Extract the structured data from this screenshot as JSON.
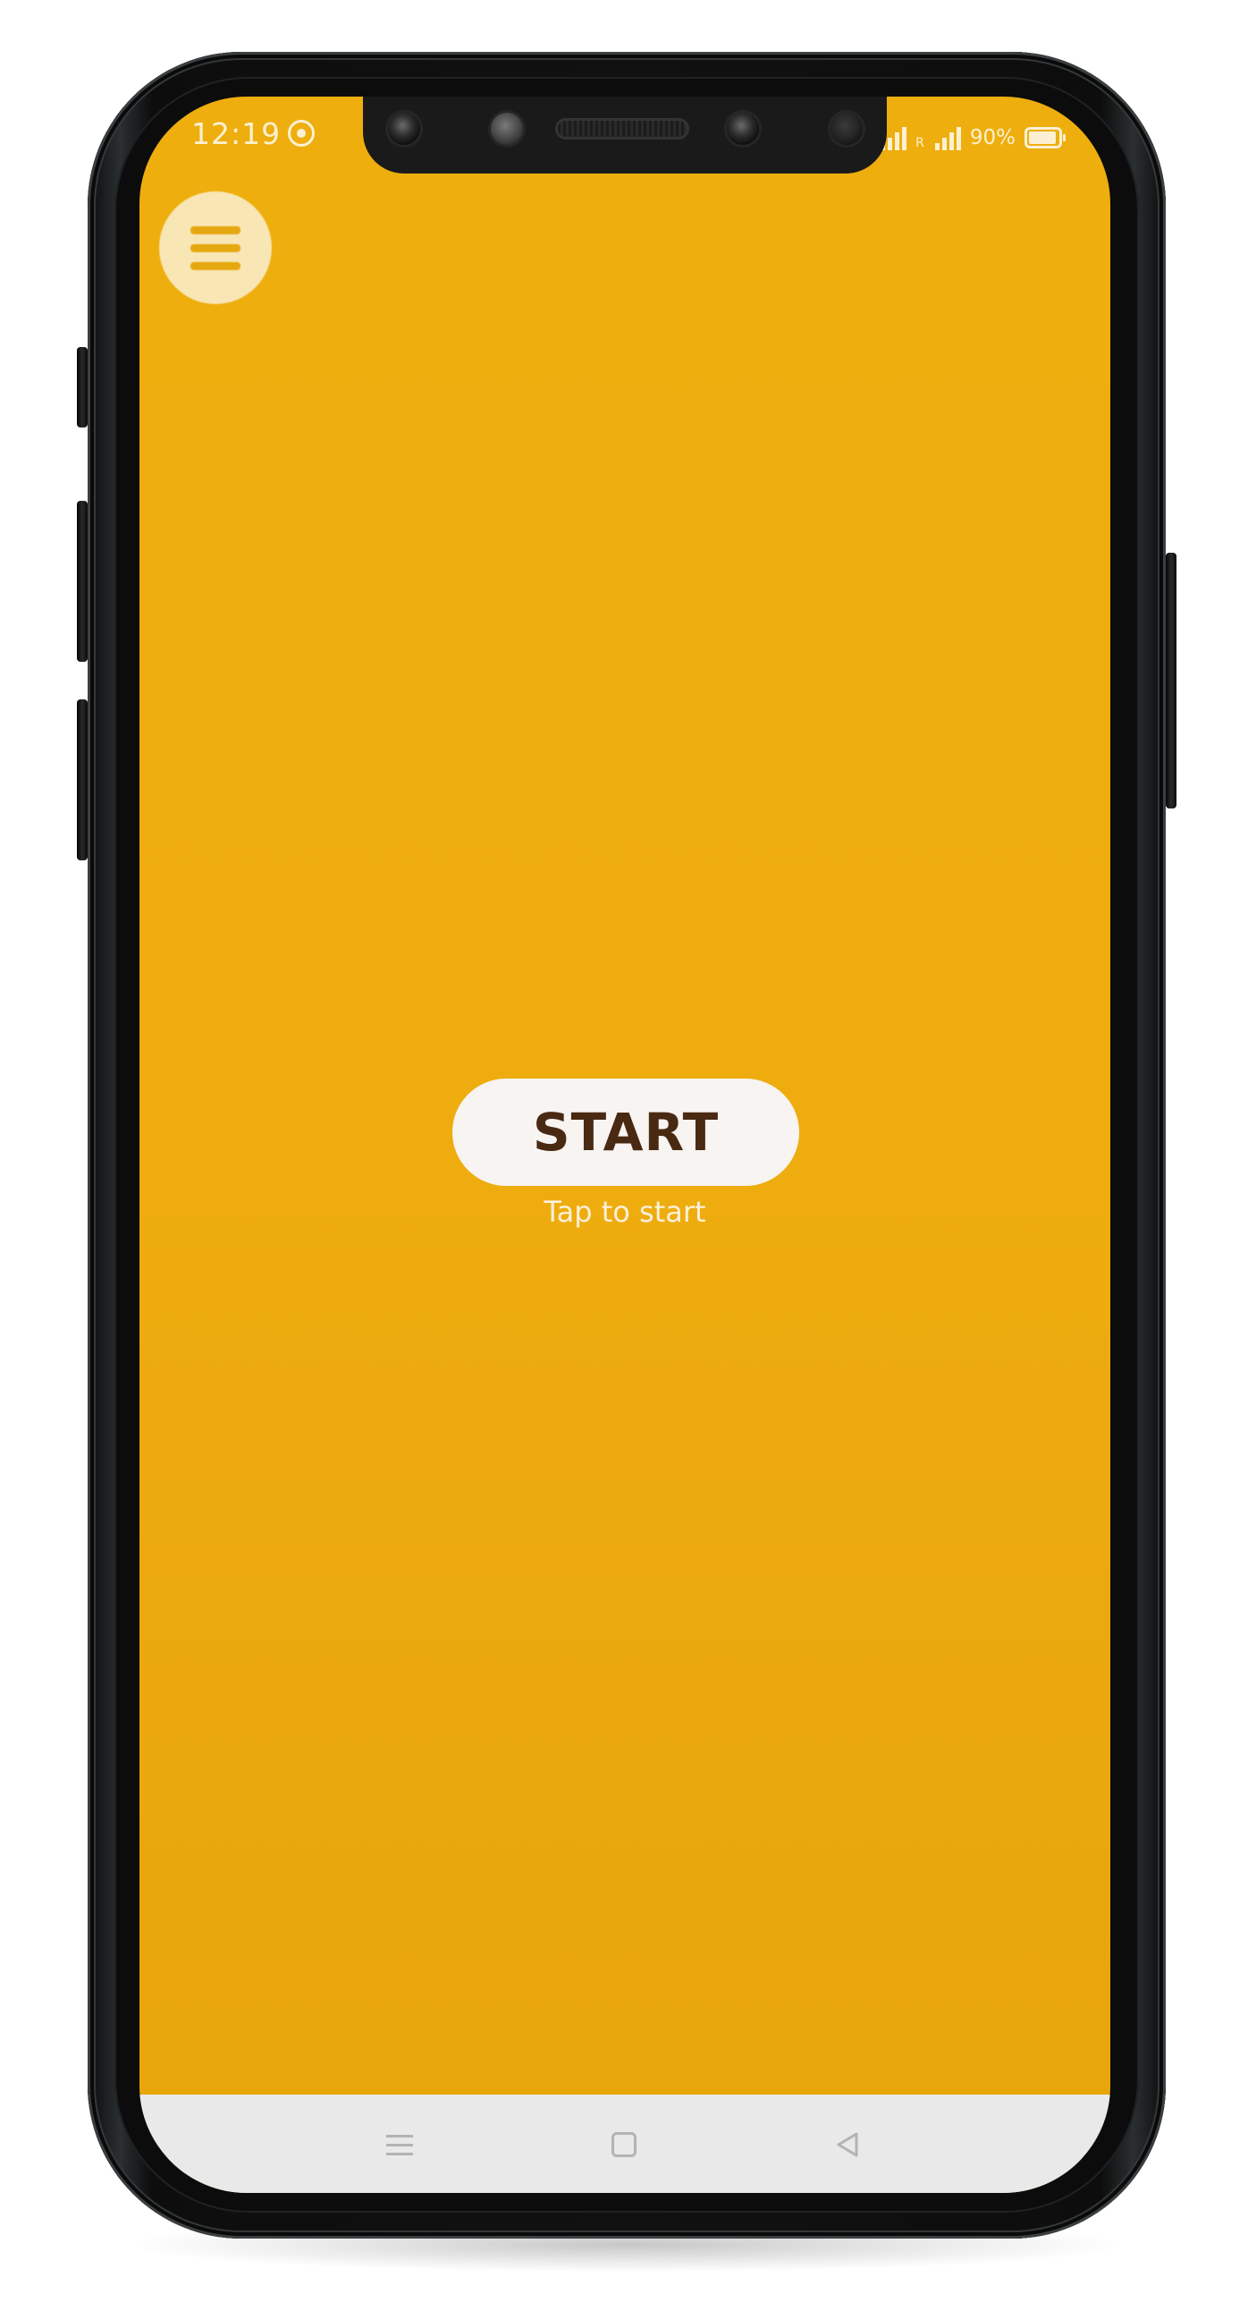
{
  "status_bar": {
    "time": "12:19",
    "battery_percent": "90%",
    "signal_roaming": "R",
    "icons": [
      "whatsapp-icon",
      "signal-icon",
      "signal-roaming-icon",
      "battery-icon"
    ]
  },
  "menu": {
    "icon": "hamburger-menu-icon"
  },
  "main": {
    "start_label": "START",
    "hint": "Tap to start"
  },
  "nav_bar": {
    "icons": [
      "recent-apps-icon",
      "home-icon",
      "back-icon"
    ]
  },
  "colors": {
    "background": "#eeac0f",
    "start_text": "#4a2912",
    "start_pill": "#f7f4f1",
    "nav_bar": "#e9e9e9"
  }
}
